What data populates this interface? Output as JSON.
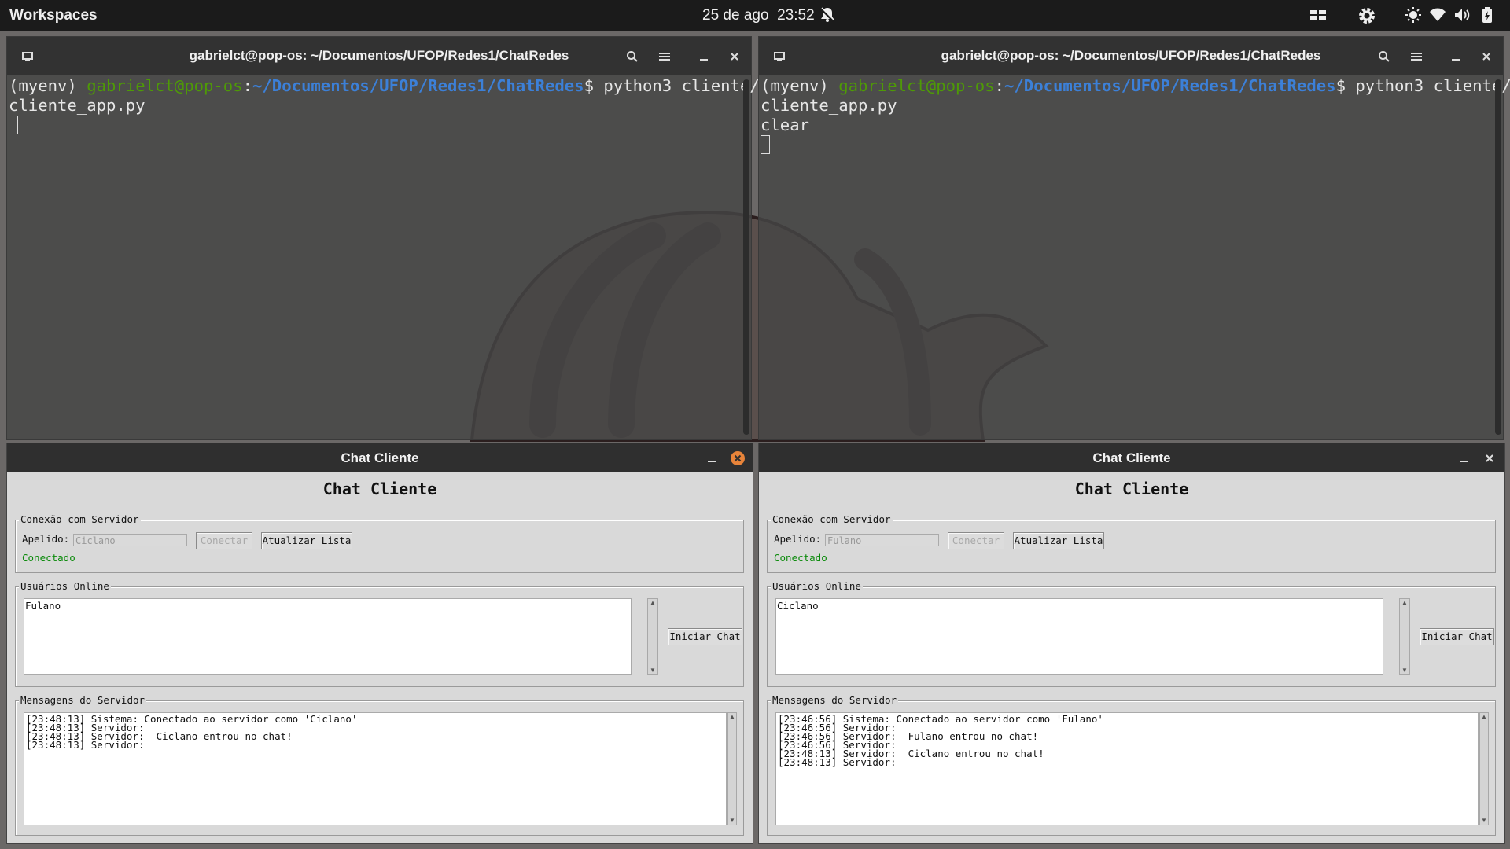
{
  "topbar": {
    "workspaces_label": "Workspaces",
    "date": "25 de ago",
    "time": "23:52",
    "icons": [
      "notifications-off-icon",
      "workspace-grid-icon",
      "settings-icon",
      "brightness-icon",
      "wifi-icon",
      "volume-icon",
      "battery-icon"
    ]
  },
  "terminal_left": {
    "title": "gabrielct@pop-os: ~/Documentos/UFOP/Redes1/ChatRedes",
    "prompt_env": "(myenv) ",
    "prompt_user": "gabrielct@pop-os",
    "prompt_colon": ":",
    "prompt_path": "~/Documentos/UFOP/Redes1/ChatRedes",
    "prompt_dollar": "$ ",
    "command_line1": "python3 cliente/",
    "command_line2": "cliente_app.py"
  },
  "terminal_right": {
    "title": "gabrielct@pop-os: ~/Documentos/UFOP/Redes1/ChatRedes",
    "prompt_env": "(myenv) ",
    "prompt_user": "gabrielct@pop-os",
    "prompt_colon": ":",
    "prompt_path": "~/Documentos/UFOP/Redes1/ChatRedes",
    "prompt_dollar": "$ ",
    "command_line1": "python3 cliente/",
    "command_line2": "cliente_app.py",
    "command_line3": "clear"
  },
  "chat_left": {
    "window_title": "Chat Cliente",
    "heading": "Chat Cliente",
    "connection_group": "Conexão com Servidor",
    "nickname_label": "Apelido:",
    "nickname_value": "Ciclano",
    "connect_button": "Conectar",
    "refresh_button": "Atualizar Lista",
    "status": "Conectado",
    "users_group": "Usuários Online",
    "users": [
      "Fulano"
    ],
    "start_chat_button": "Iniciar Chat",
    "messages_group": "Mensagens do Servidor",
    "messages": [
      "[23:48:13] Sistema: Conectado ao servidor como 'Ciclano'",
      "[23:48:13] Servidor: ",
      "[23:48:13] Servidor:  Ciclano entrou no chat!",
      "[23:48:13] Servidor: "
    ]
  },
  "chat_right": {
    "window_title": "Chat Cliente",
    "heading": "Chat Cliente",
    "connection_group": "Conexão com Servidor",
    "nickname_label": "Apelido:",
    "nickname_value": "Fulano",
    "connect_button": "Conectar",
    "refresh_button": "Atualizar Lista",
    "status": "Conectado",
    "users_group": "Usuários Online",
    "users": [
      "Ciclano"
    ],
    "start_chat_button": "Iniciar Chat",
    "messages_group": "Mensagens do Servidor",
    "messages": [
      "[23:46:56] Sistema: Conectado ao servidor como 'Fulano'",
      "[23:46:56] Servidor: ",
      "[23:46:56] Servidor:  Fulano entrou no chat!",
      "[23:46:56] Servidor: ",
      "[23:48:13] Servidor:  Ciclano entrou no chat!",
      "[23:48:13] Servidor: "
    ]
  },
  "colors": {
    "prompt_user": "#4e9a06",
    "prompt_path": "#3c80d8",
    "status_ok": "#0a8a0a",
    "close_active": "#e8843a"
  }
}
